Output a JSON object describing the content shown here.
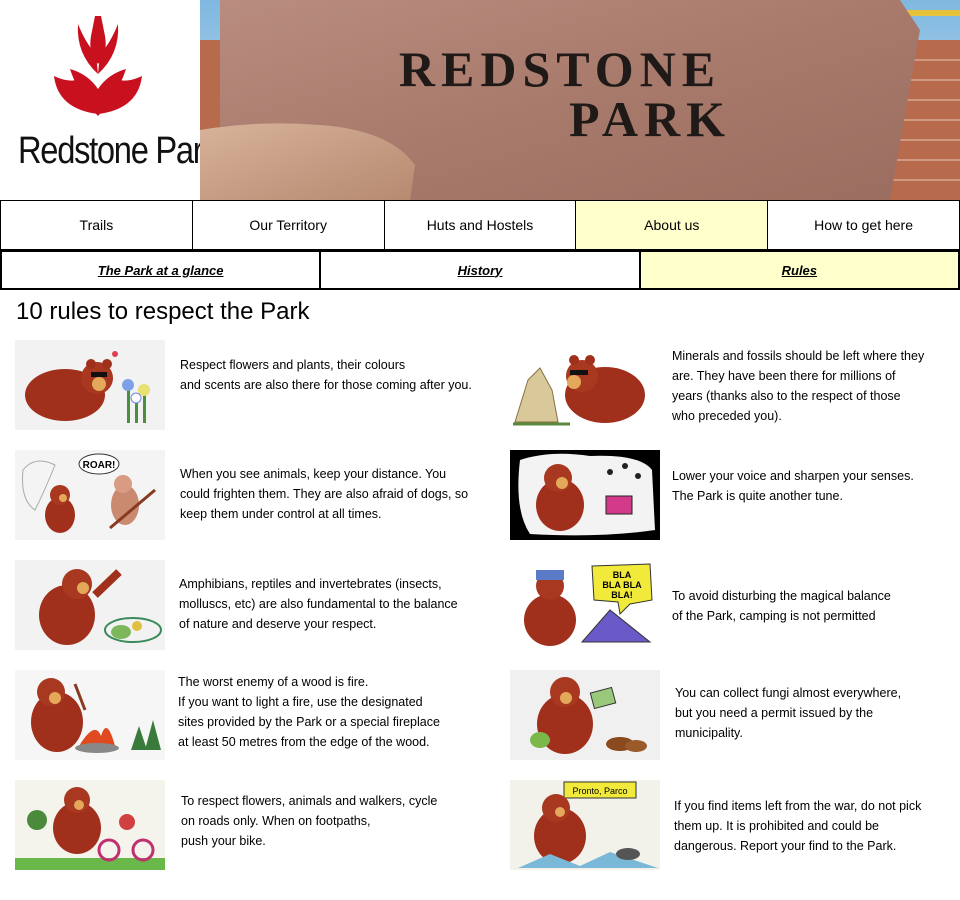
{
  "brand": {
    "logo_text": "Redstone Park",
    "banner_line1": "REDSTONE",
    "banner_line2": "PARK",
    "logo_color": "#c8101e"
  },
  "nav": {
    "main": [
      {
        "label": "Trails",
        "active": false
      },
      {
        "label": "Our Territory",
        "active": false
      },
      {
        "label": "Huts and Hostels",
        "active": false
      },
      {
        "label": "About us",
        "active": true
      },
      {
        "label": "How to get here",
        "active": false
      }
    ],
    "sub": [
      {
        "label": "The Park at a glance",
        "active": false
      },
      {
        "label": "History",
        "active": false
      },
      {
        "label": "Rules",
        "active": true
      }
    ],
    "active_color": "#ffffcc"
  },
  "page": {
    "title": "10 rules to respect the Park"
  },
  "rules": [
    {
      "icon": "bear-flowers-illustration",
      "lines": [
        "Respect flowers and plants, their colours",
        "and scents are also there for those coming after you."
      ]
    },
    {
      "icon": "bear-fossils-illustration",
      "lines": [
        "Minerals and fossils should be left where they",
        "are.  They have been there for millions of",
        "years (thanks also to the respect of those",
        "who preceded you)."
      ]
    },
    {
      "icon": "bear-roar-illustration",
      "lines": [
        "When you see animals, keep your distance. You",
        "could frighten them.  They are also afraid of dogs, so",
        "keep them under control at all times."
      ]
    },
    {
      "icon": "bear-music-illustration",
      "lines": [
        "Lower your voice and sharpen your senses.",
        "The Park is quite another tune."
      ]
    },
    {
      "icon": "bear-amphibians-illustration",
      "lines": [
        "Amphibians, reptiles and invertebrates (insects,",
        "molluscs, etc) are also fundamental to the balance",
        "of nature and deserve your respect."
      ]
    },
    {
      "icon": "bear-camping-illustration",
      "bubble": "BLA BLA BLA BLA!",
      "lines": [
        "To avoid disturbing the magical balance",
        "of the Park, camping is not permitted"
      ]
    },
    {
      "icon": "bear-fire-illustration",
      "lines": [
        "The worst enemy of a wood is fire.",
        "If you want to light a fire, use the designated",
        "sites provided by the Park or a special fireplace",
        "at least 50 metres from the edge of the wood."
      ]
    },
    {
      "icon": "bear-fungi-illustration",
      "lines": [
        "You can collect fungi almost everywhere,",
        "but you need a permit issued by the",
        "municipality."
      ]
    },
    {
      "icon": "bear-cycling-illustration",
      "lines": [
        "To respect flowers, animals and walkers, cycle",
        "on roads only.  When on footpaths,",
        "push your bike."
      ]
    },
    {
      "icon": "bear-war-items-illustration",
      "sign": "Pronto, Parco",
      "lines": [
        "If you find items left from the war, do not pick",
        "them up. It is prohibited and could be",
        "dangerous.  Report your find to the Park."
      ]
    }
  ]
}
